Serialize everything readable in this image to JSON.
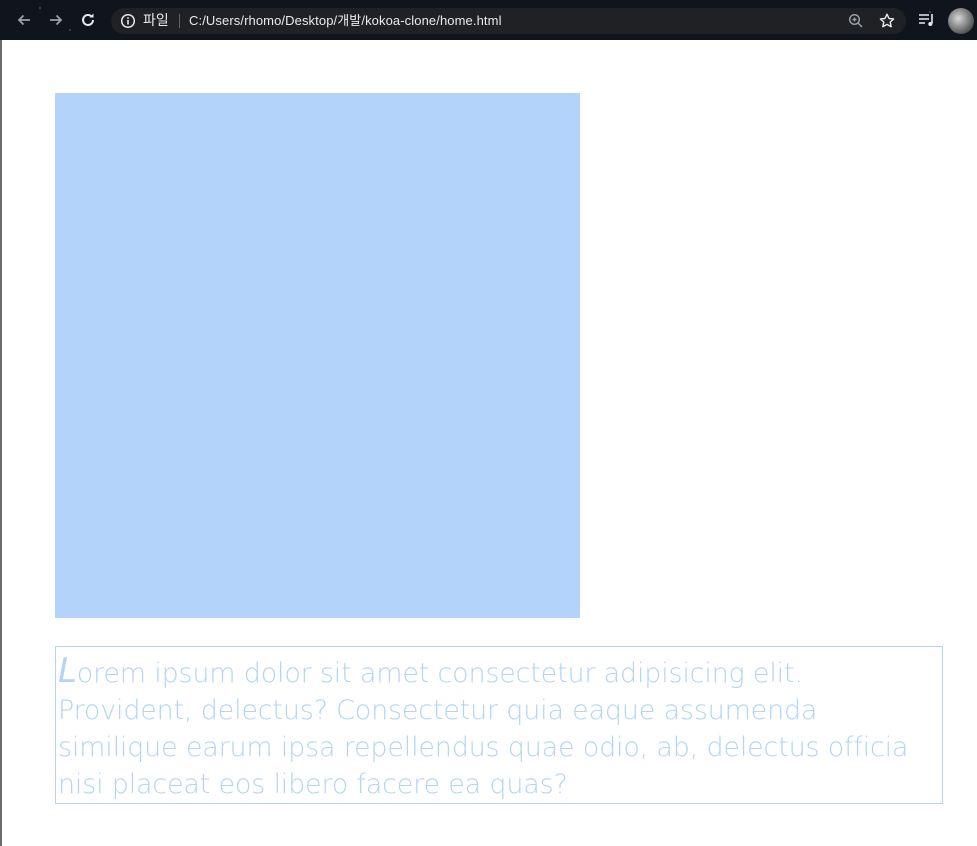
{
  "browser": {
    "omnibox": {
      "chip_label": "파일",
      "url": "C:/Users/rhomo/Desktop/개발/kokoa-clone/home.html"
    },
    "icons": [
      "back-arrow-icon",
      "forward-arrow-icon",
      "reload-icon",
      "info-icon",
      "zoom-icon",
      "star-icon",
      "media-control-icon",
      "profile-avatar"
    ],
    "colors": {
      "toolbar": "#10141c",
      "omnibox": "#202124",
      "text": "#e8eaed"
    }
  },
  "page": {
    "paragraph": {
      "first_letter": "L",
      "rest": "orem ipsum dolor sit amet consectetur adipisicing elit. Provident, delectus? Consectetur quia eaque assumenda similique earum ipsa repellendus quae odio, ab, delectus officia nisi placeat eos libero facere ea quas?"
    },
    "colors": {
      "box": "#b3d3fb",
      "text": "#b3d3fb",
      "background": "#ffffff"
    }
  }
}
